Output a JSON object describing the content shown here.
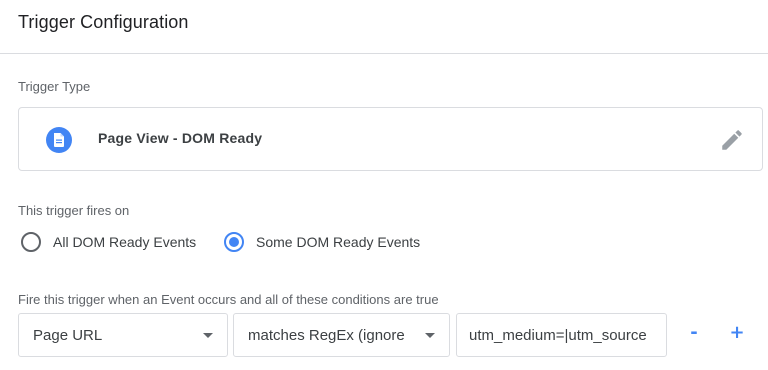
{
  "header": {
    "title": "Trigger Configuration"
  },
  "trigger_type": {
    "label": "Trigger Type",
    "name": "Page View - DOM Ready",
    "icon": "page-document-icon",
    "edit_icon": "pencil-icon"
  },
  "fires_on": {
    "label": "This trigger fires on",
    "options": [
      {
        "label": "All DOM Ready Events",
        "selected": false
      },
      {
        "label": "Some DOM Ready Events",
        "selected": true
      }
    ]
  },
  "condition": {
    "label": "Fire this trigger when an Event occurs and all of these conditions are true",
    "variable": "Page URL",
    "operator": "matches RegEx (ignore",
    "value": "utm_medium=|utm_source",
    "remove_label": "-",
    "add_label": "+"
  },
  "colors": {
    "accent": "#4285f4",
    "border": "#dadce0",
    "label": "#5f6368"
  }
}
